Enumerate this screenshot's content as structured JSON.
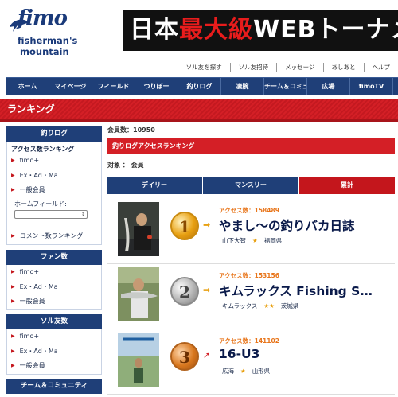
{
  "brand": {
    "logo": "fimo",
    "tagline1": "fisherman's",
    "tagline2": "mountain"
  },
  "banner": {
    "pre": "日本",
    "red": "最大級",
    "post": "WEBトーナメ"
  },
  "topnav": [
    "ソル友を探す",
    "ソル友招待",
    "メッセージ",
    "あしあと",
    "ヘルプ"
  ],
  "mainnav": [
    "ホーム",
    "マイページ",
    "フィールド",
    "つりぼー",
    "釣りログ",
    "凄腕",
    "チーム＆コミュ",
    "広場",
    "fimoTV"
  ],
  "page_title": "ランキング",
  "sidebar": {
    "tsurilog": {
      "head": "釣りログ",
      "section": "アクセス数ランキング",
      "items": [
        "fimo+",
        "Ex・Ad・Ma",
        "一般会員"
      ],
      "field_label": "ホームフィールド:",
      "comment_rank": "コメント数ランキング"
    },
    "fans": {
      "head": "ファン数",
      "items": [
        "fimo+",
        "Ex・Ad・Ma",
        "一般会員"
      ]
    },
    "sol": {
      "head": "ソル友数",
      "items": [
        "fimo+",
        "Ex・Ad・Ma",
        "一般会員"
      ]
    },
    "team": {
      "head": "チーム＆コミュニティ"
    }
  },
  "main": {
    "members": "会員数：10950",
    "subtitle": "釣りログアクセスランキング",
    "target": "対象 ： 会員",
    "tabs": [
      {
        "label": "デイリー",
        "active": false
      },
      {
        "label": "マンスリー",
        "active": false
      },
      {
        "label": "累計",
        "active": true
      }
    ],
    "ranks": [
      {
        "rank": "1",
        "access": "アクセス数：158489",
        "title": "やまし～の釣りバカ日誌",
        "user": "山下大智",
        "stars": "★",
        "pref": "福岡県",
        "medal_color": "#e8a011",
        "arrow": "➡",
        "arrow_color": "#e8a011"
      },
      {
        "rank": "2",
        "access": "アクセス数：153156",
        "title": "キムラックス Fishing S…",
        "user": "キムラックス",
        "stars": "★★",
        "pref": "茨城県",
        "medal_color": "#9a9a9a",
        "arrow": "➡",
        "arrow_color": "#e8a011"
      },
      {
        "rank": "3",
        "access": "アクセス数：141102",
        "title": "16-U3",
        "user": "広海",
        "stars": "★",
        "pref": "山形県",
        "medal_color": "#d9781f",
        "arrow": "➚",
        "arrow_color": "#d41f26"
      }
    ]
  }
}
